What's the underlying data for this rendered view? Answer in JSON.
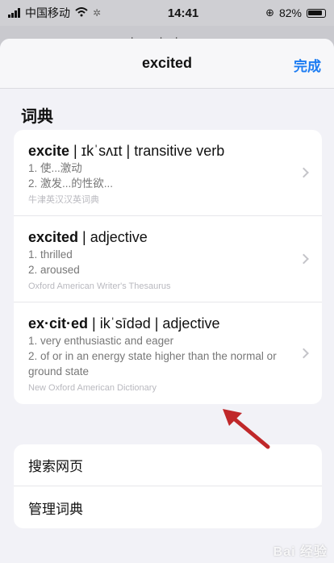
{
  "status_bar": {
    "carrier": "中国移动",
    "time": "14:41",
    "battery": "82%"
  },
  "background_page": {
    "url": "a.docs.docker.com"
  },
  "sheet": {
    "title": "excited",
    "done_label": "完成",
    "section_title": "词典"
  },
  "entries": [
    {
      "word": "excite",
      "rest": " | ɪkˈsʌɪt | transitive verb",
      "line1": "1. 使...激动",
      "line2": "2. 激发...的性欲...",
      "source": "牛津英汉汉英词典"
    },
    {
      "word": "excited",
      "rest": " | adjective",
      "line1": "1. thrilled",
      "line2": "2. aroused",
      "source": "Oxford American Writer's Thesaurus"
    },
    {
      "word": "ex·cit·ed",
      "rest": " | ikˈsīdəd | adjective",
      "line1": "1. very enthusiastic and eager",
      "line2": "2. of or in an energy state higher than the normal or ground state",
      "source": "New Oxford American Dictionary"
    }
  ],
  "actions": {
    "search_web": "搜索网页",
    "manage_dictionaries": "管理词典"
  },
  "watermark": "Bai 经验",
  "colors": {
    "accent": "#1c7cf2",
    "annotation_arrow": "#c0282a"
  }
}
